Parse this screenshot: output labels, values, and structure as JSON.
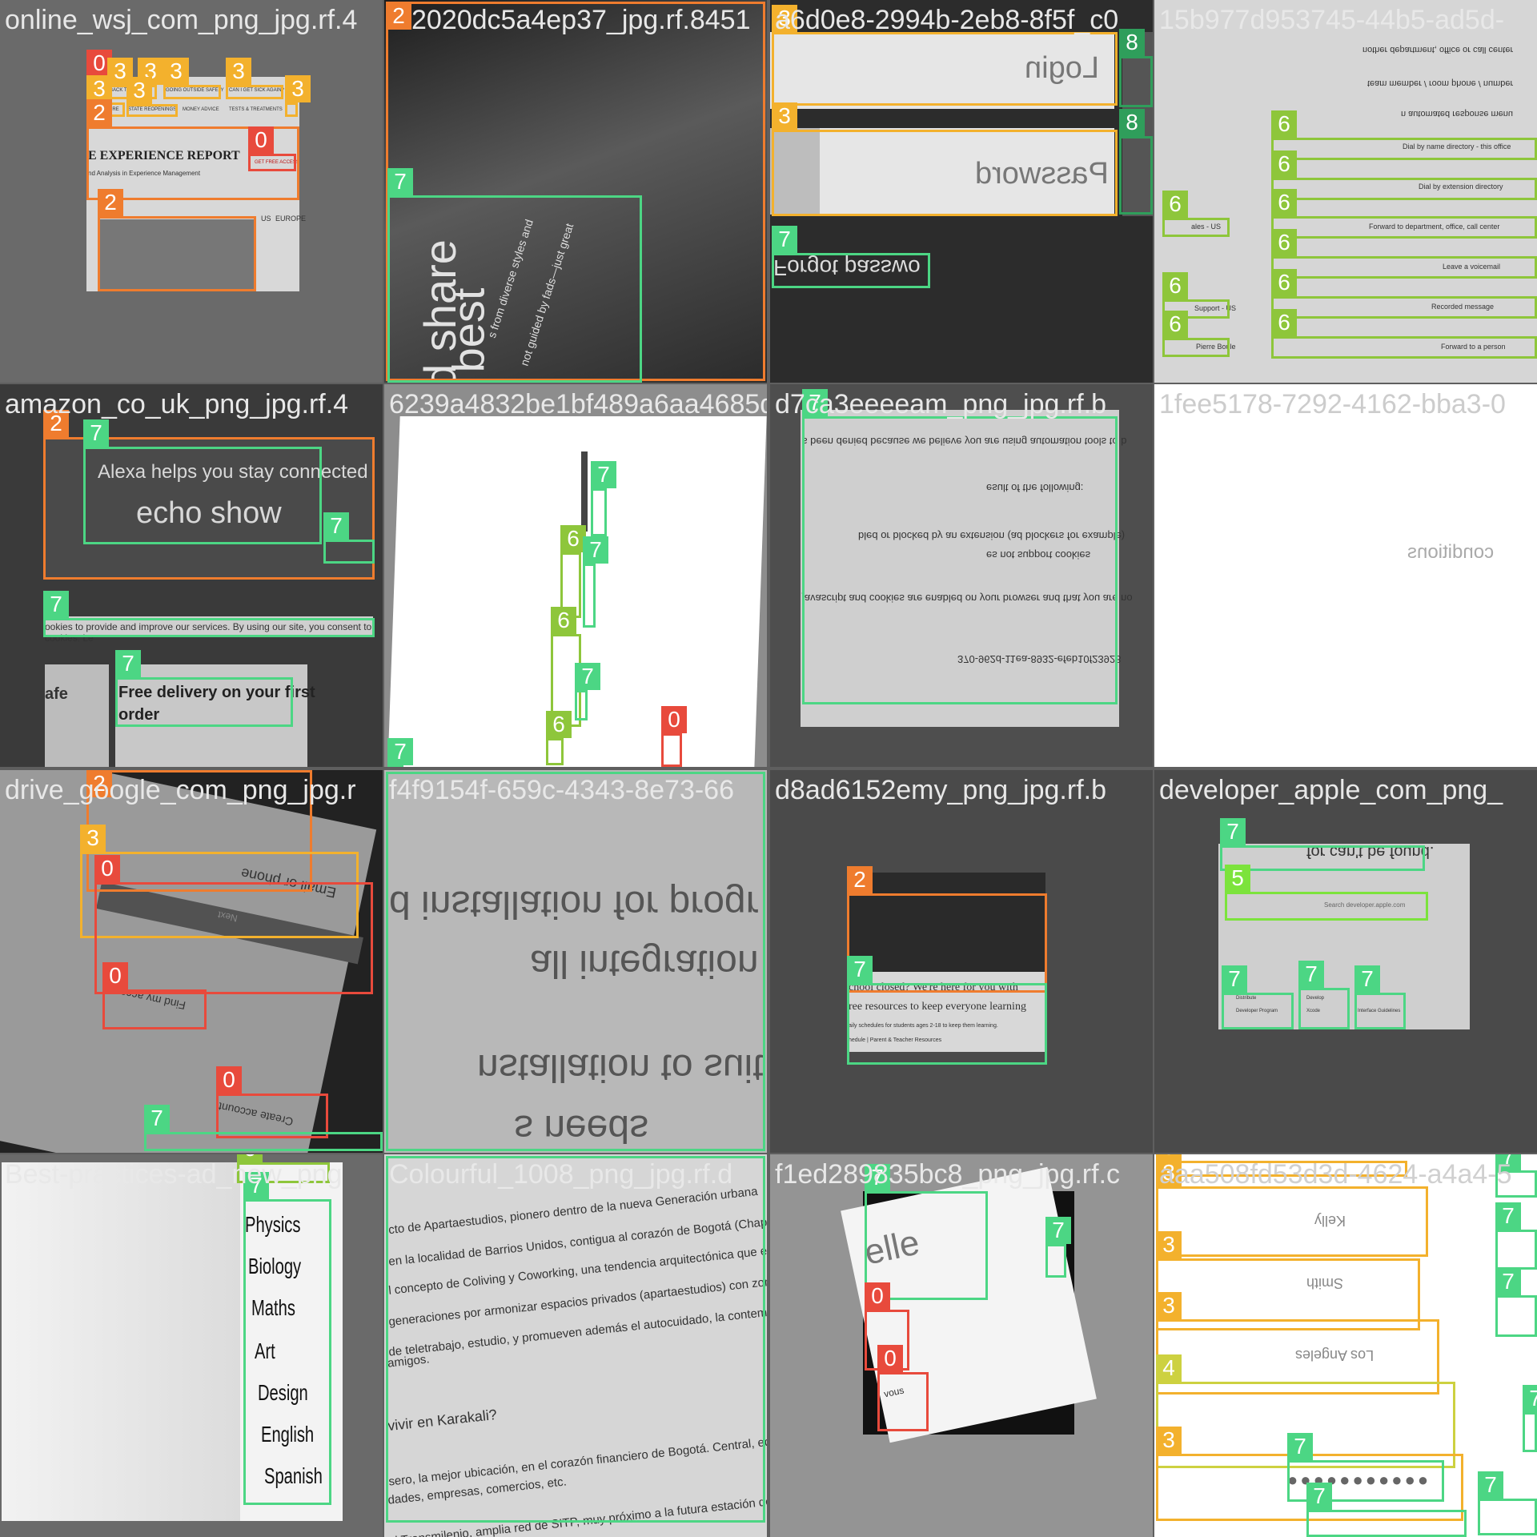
{
  "colors": {
    "class0": "#e84a3c",
    "class2": "#ef7c2e",
    "class3": "#f3b12d",
    "class4": "#cdd140",
    "class5": "#7ce33c",
    "class6": "#8ec63b",
    "class7": "#4cd684",
    "class8": "#2f9e5b"
  },
  "tiles": [
    {
      "title": "online_wsj_com_png_jpg.rf.4",
      "t2": "2020dc5a4ep37_jpg.rf.8451",
      "report": "E EXPERIENCE REPORT",
      "sub": "nd Analysis in Experience Management",
      "free": "GET FREE ACCESS",
      "us": "US",
      "eu": "EUROPE",
      "nav": [
        "BACK T",
        "AS",
        "GOING OUTSIDE SAFELY",
        "CAN I GET SICK AGAIN?",
        "SURE",
        "STATE REOPENINGS",
        "MONEY ADVICE",
        "TESTS & TREATMENTS"
      ]
    },
    {
      "title": "2020dc5a4ep37_jpg.rf.8451",
      "quote1": "d share",
      "quote2": "best",
      "quote3": "s from diverse styles and",
      "quote4": "not guided by fads—just great"
    },
    {
      "title": "a6d0e8-2994b-2eb8-8f5f_c0",
      "login": "Login",
      "password": "Password",
      "forgot": "Forgot passwo"
    },
    {
      "title": "15b977d953745-44b5-ad5d-",
      "lines": [
        "nother department, office or call center",
        "team member / room phone / number",
        "n automated response menu"
      ],
      "items": [
        "Dial by name directory - this office",
        "Dial by extension directory",
        "Forward to department, office, call center",
        "Leave a voicemail",
        "Recorded message",
        "Forward to a person"
      ],
      "left": [
        "ales - US",
        "Support - US",
        "Pierre Boule"
      ]
    },
    {
      "title": "amazon_co_uk_png_jpg.rf.4",
      "alexa": "Alexa helps you stay connected",
      "echo": "echo show",
      "cookies": "ookies to provide and improve our services. By using our site, you consent to cookies. Le",
      "afe": "afe",
      "delivery1": "Free delivery on your first",
      "delivery2": "order"
    },
    {
      "title": "6239a4832be1bf489a6aa4685d7"
    },
    {
      "title": "d7ca3eeeeam_png_jpg.rf.b",
      "l1": "s been denied because we believe you are using automation tools to b",
      "l2": "esult of the following:",
      "l3": "bled or blocked by an extension (ad blockers for example)",
      "l4": "es not support cookies",
      "l5": "javascript and cookies are enabled on your browser and that you are no",
      "l6": "370-962d-11ea-8932-efeb10f23928"
    },
    {
      "title": "1fee5178-7292-4162-bba3-0",
      "cond": "conditions"
    },
    {
      "title": "drive_google_com_png_jpg.r",
      "email": "Email or phone",
      "next": "Next",
      "find": "Find my account",
      "create": "Create account"
    },
    {
      "title": "f4f9154f-659c-4343-8e73-66",
      "l1": "d installation for progr",
      "l2": "all integration",
      "l3": "nstallation to suit your",
      "l4": "s needs"
    },
    {
      "title": "d8ad6152emy_png_jpg.rf.b",
      "school1": "chool closed? We're here for you with",
      "school2": "ree resources to keep everyone learning",
      "school3": "aily schedules for students ages 2-18 to keep them learning.",
      "school4": "hedule | Parent & Teacher Resources"
    },
    {
      "title": "developer_apple_com_png_",
      "found": "for can't be found.",
      "search": "Search developer.apple.com",
      "col1a": "Distribute",
      "col1b": "Developer Program",
      "col2a": "Develop",
      "col2b": "Xcode",
      "col3": "Interface Guidelines"
    },
    {
      "title": "Best-practices-ad_new_png",
      "subjects": [
        "Physics",
        "Biology",
        "Maths",
        "Art",
        "Design",
        "English",
        "Spanish"
      ]
    },
    {
      "title": "Colourful_1008_png_jpg.rf.d",
      "p1": "cto de Apartaestudios, pionero dentro de la nueva Generación urbana",
      "p2": "en la localidad de Barrios Unidos, contigua al corazón de Bogotá (Chapinero). E",
      "p3": "l concepto de Coliving y Coworking, una tendencia arquitectónica que está",
      "p4": "generaciones por armonizar espacios privados (apartaestudios) con zonas sociales",
      "p5": "de teletrabajo, estudio, y promueven además el autocuidado, la contemplación y el",
      "p6": "amigos.",
      "p7": "vivir en Karakali?",
      "p8": "sero, la mejor ubicación, en el corazón financiero de Bogotá. Central, equidistante,",
      "p9": "dades, empresas, comercios, etc.",
      "p10": "al Transmilenio, amplia red de SITP, muy próximo a la futura estación de metro"
    },
    {
      "title": "f1ed289835bc8_png_jpg.rf.c",
      "elle": "elle",
      "vous": "vous"
    },
    {
      "title": "aaa508fd53d3d-4624-a4a4-5",
      "kelly": "Kelly",
      "smith": "Smith",
      "la": "Los Angeles"
    }
  ]
}
